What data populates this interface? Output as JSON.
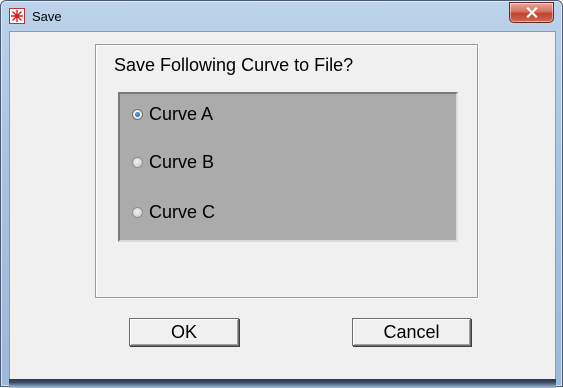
{
  "window": {
    "title": "Save",
    "icon": "save-app-icon",
    "close_icon": "close-icon"
  },
  "dialog": {
    "prompt": "Save Following Curve to File?",
    "options": [
      {
        "label": "Curve A",
        "checked": true
      },
      {
        "label": "Curve B",
        "checked": false
      },
      {
        "label": "Curve C",
        "checked": false
      }
    ],
    "ok_label": "OK",
    "cancel_label": "Cancel"
  },
  "colors": {
    "titlebar": "#a9c4e0",
    "panel_gray": "#ababab",
    "client_bg": "#f0f0f0",
    "close_red": "#c0432d"
  }
}
